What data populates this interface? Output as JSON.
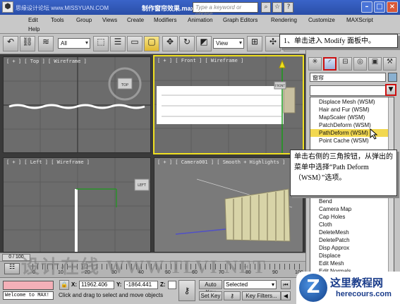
{
  "window": {
    "watermark_top": "思缘设计论坛 www.MISSYUAN.COM",
    "doc_title": "制作窗帘效果.max",
    "search_placeholder": "Type a keyword or phrase"
  },
  "menu": [
    "Edit",
    "Tools",
    "Group",
    "Views",
    "Create",
    "Modifiers",
    "Animation",
    "Graph Editors",
    "Rendering",
    "Customize",
    "MAXScript",
    "Help"
  ],
  "toolbar": {
    "selection_filter": "All",
    "reference_coord": "View"
  },
  "viewports": {
    "top": "[ + ] [ Top ] [ Wireframe ]",
    "front": "[ + ] [ Front ] [ Wireframe ]",
    "left": "[ + ] [ Left ] [ Wireframe ]",
    "camera": "[ + ] [ Camera001 ] [ Smooth + Highlights ]",
    "viewcube_top": "TOP",
    "viewcube_front": "FRONT",
    "viewcube_left": "LEFT"
  },
  "command_panel": {
    "object_name": "窗帘",
    "modifier_list": [
      "Displace Mesh (WSM)",
      "Hair and Fur (WSM)",
      "MapScaler (WSM)",
      "PatchDeform (WSM)",
      "PathDeform (WSM)",
      "Point Cache (WSM)",
      "Bend",
      "Camera Map",
      "Cap Holes",
      "Cloth",
      "DeleteMesh",
      "DeletePatch",
      "Disp Approx",
      "Displace",
      "Edit Mesh",
      "Edit Normals"
    ],
    "selected_modifier": "PathDeform (WSM)"
  },
  "callouts": {
    "step1": "1、单击进入 Modify 面板中。",
    "step2": "单击右侧的三角按钮，从弹出的菜单中选择“Path Deform（WSM）”选项。"
  },
  "timeline": {
    "frame": "0 / 100",
    "tick_labels": [
      "0",
      "10",
      "20",
      "30",
      "40",
      "50",
      "60",
      "70",
      "80",
      "90",
      "100"
    ]
  },
  "watermark_bottom": "设计在线 WWW.TLVI.NET",
  "statusbar": {
    "maxscript": "Welcome to MAX!",
    "x_label": "X:",
    "x_value": "11962.406",
    "y_label": "Y:",
    "y_value": "-1864.441",
    "z_label": "Z:",
    "auto_key": "Auto Key",
    "set_key": "Set Key",
    "selected": "Selected",
    "key_filters": "Key Filters...",
    "prompt": "Click and drag to select and move objects"
  },
  "logo": {
    "mark": "Z",
    "title": "这里教程网",
    "subtitle": "herecours.com"
  },
  "colors": {
    "highlight_red": "#cc1010",
    "active_viewport": "#f0e020",
    "selected_item": "#f2d850"
  }
}
